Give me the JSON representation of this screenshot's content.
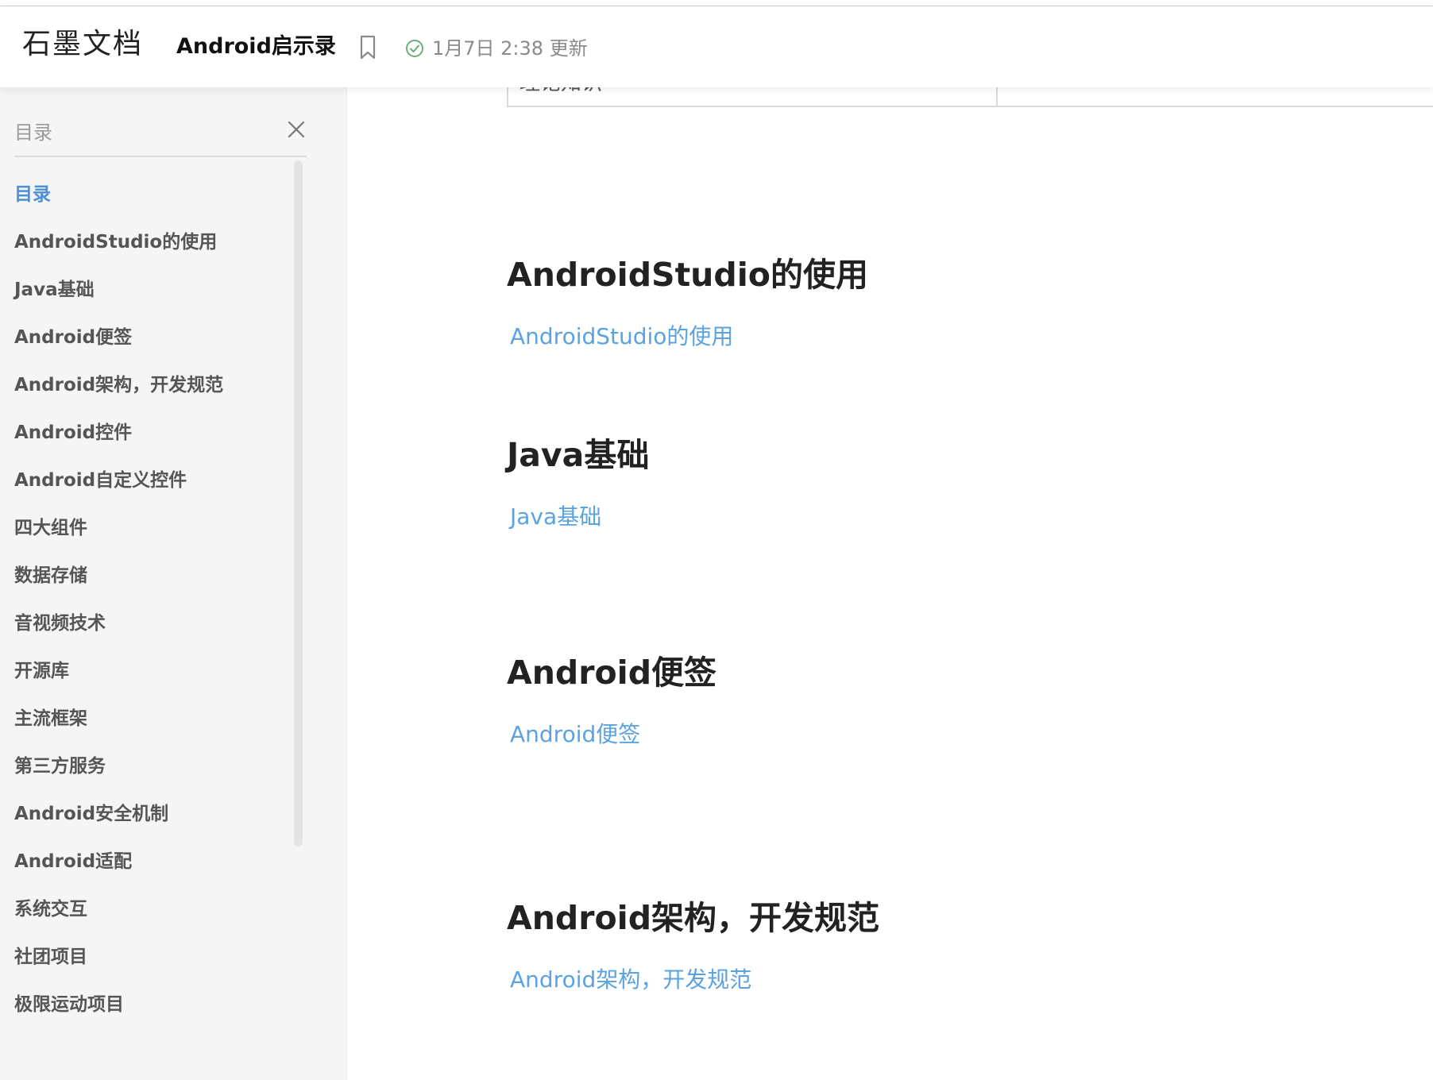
{
  "header": {
    "brand": "石墨文档",
    "doc_title": "Android启示录",
    "status_text": "1月7日 2:38 更新",
    "icons": {
      "bookmark": "bookmark-icon",
      "status": "check-circle-icon"
    }
  },
  "sidebar": {
    "title": "目录",
    "close_icon": "close-icon",
    "items": [
      {
        "label": "目录",
        "active": true
      },
      {
        "label": "AndroidStudio的使用"
      },
      {
        "label": "Java基础"
      },
      {
        "label": "Android便签"
      },
      {
        "label": "Android架构，开发规范"
      },
      {
        "label": "Android控件"
      },
      {
        "label": "Android自定义控件"
      },
      {
        "label": "四大组件"
      },
      {
        "label": "数据存储"
      },
      {
        "label": "音视频技术"
      },
      {
        "label": "开源库"
      },
      {
        "label": "主流框架"
      },
      {
        "label": "第三方服务"
      },
      {
        "label": "Android安全机制"
      },
      {
        "label": "Android适配"
      },
      {
        "label": "系统交互"
      },
      {
        "label": "社团项目"
      },
      {
        "label": "极限运动项目"
      }
    ]
  },
  "content": {
    "table_fragment_text": "理论知识",
    "sections": [
      {
        "heading": "AndroidStudio的使用",
        "link": "AndroidStudio的使用"
      },
      {
        "heading": "Java基础",
        "link": "Java基础"
      },
      {
        "heading": "Android便签",
        "link": "Android便签"
      },
      {
        "heading": "Android架构，开发规范",
        "link": "Android架构，开发规范"
      }
    ]
  },
  "colors": {
    "accent": "#4a8fd8",
    "link": "#5aa3e0",
    "sidebar_bg": "#f5f5f5",
    "muted_text": "#8a8a8a"
  }
}
